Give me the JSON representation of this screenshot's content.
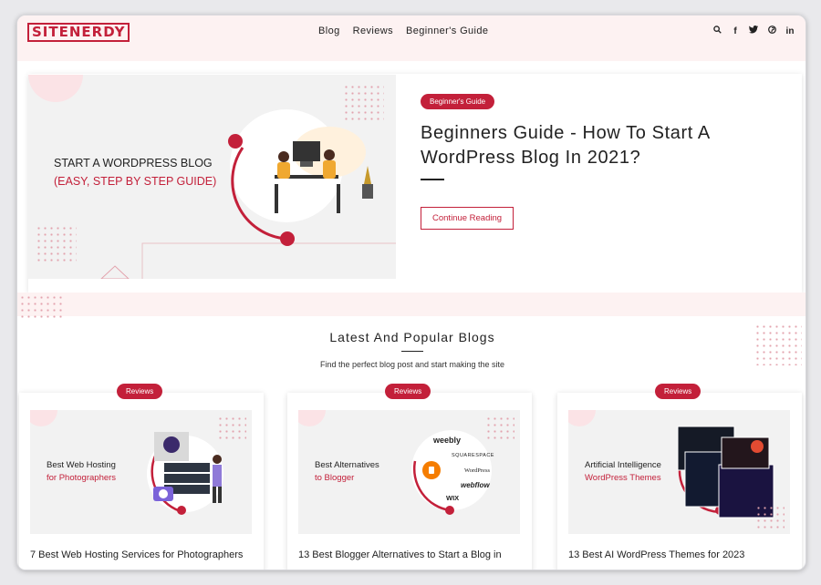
{
  "header": {
    "logo": "SITENERDY",
    "nav": [
      "Blog",
      "Reviews",
      "Beginner's Guide"
    ],
    "icons": [
      "search-icon",
      "facebook-icon",
      "twitter-icon",
      "pinterest-icon",
      "linkedin-icon"
    ]
  },
  "hero": {
    "image_text_line1": "START A WORDPRESS BLOG",
    "image_text_line2": "(EASY, STEP BY STEP GUIDE)",
    "badge": "Beginner's Guide",
    "title": "Beginners Guide - How To Start A WordPress Blog In 2021?",
    "cta": "Continue Reading"
  },
  "latest": {
    "title": "Latest And Popular Blogs",
    "subtitle": "Find the perfect blog post and start making the site",
    "cards": [
      {
        "badge": "Reviews",
        "img_line1": "Best Web Hosting",
        "img_line2": "for Photographers",
        "title": "7 Best Web Hosting Services for Photographers"
      },
      {
        "badge": "Reviews",
        "img_line1": "Best Alternatives",
        "img_line2": "to Blogger",
        "title": "13 Best Blogger Alternatives to Start a Blog in",
        "logos": [
          "weebly",
          "SQUARESPACE",
          "WordPress",
          "webflow",
          "WIX"
        ]
      },
      {
        "badge": "Reviews",
        "img_line1": "Artificial Intelligence",
        "img_line2": "WordPress Themes",
        "title": "13 Best AI WordPress Themes for 2023"
      }
    ]
  },
  "colors": {
    "accent": "#c3203a",
    "header_bg": "#fdf2f2"
  }
}
